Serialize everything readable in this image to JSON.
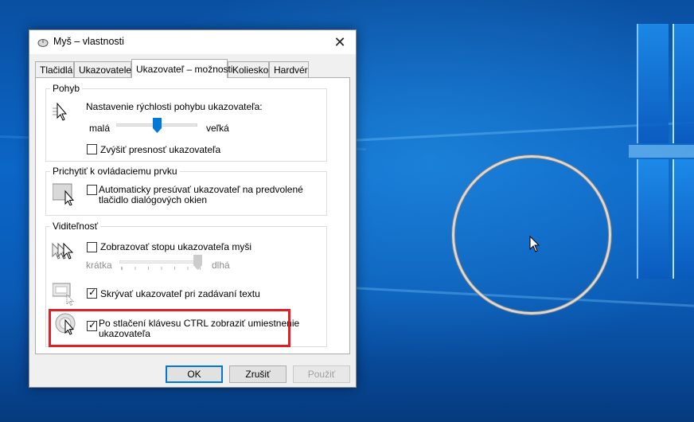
{
  "window": {
    "title": "Myš – vlastnosti",
    "close_glyph": "✕"
  },
  "tabs": [
    {
      "label": "Tlačidlá",
      "active": false
    },
    {
      "label": "Ukazovatele",
      "active": false
    },
    {
      "label": "Ukazovateľ – možnosti",
      "active": true
    },
    {
      "label": "Koliesko",
      "active": false
    },
    {
      "label": "Hardvér",
      "active": false
    }
  ],
  "motion": {
    "group_label": "Pohyb",
    "speed_label": "Nastavenie rýchlosti pohybu ukazovateľa:",
    "slow_label": "malá",
    "fast_label": "veľká",
    "speed_level": 0.5,
    "precision_label": "Zvýšiť presnosť ukazovateľa",
    "precision_checked": false
  },
  "snap": {
    "group_label": "Prichytiť k ovládaciemu prvku",
    "auto_label_line1": "Automaticky presúvať ukazovateľ na predvolené",
    "auto_label_line2": "tlačidlo dialógových okien",
    "auto_checked": false
  },
  "visibility": {
    "group_label": "Viditeľnosť",
    "trails_label": "Zobrazovať stopu ukazovateľa myši",
    "trails_checked": false,
    "short_label": "krátka",
    "long_label": "dlhá",
    "trail_level": 1.0,
    "hide_label": "Skrývať ukazovateľ pri zadávaní textu",
    "hide_checked": true,
    "ctrl_label_line1": "Po stlačení klávesu CTRL zobraziť umiestnenie",
    "ctrl_label_line2": "ukazovateľa",
    "ctrl_checked": true,
    "check_glyph": "✓"
  },
  "buttons": {
    "ok": "OK",
    "cancel": "Zrušiť",
    "apply": "Použiť"
  },
  "colors": {
    "accent": "#0078d7",
    "highlight": "#e31e24"
  }
}
